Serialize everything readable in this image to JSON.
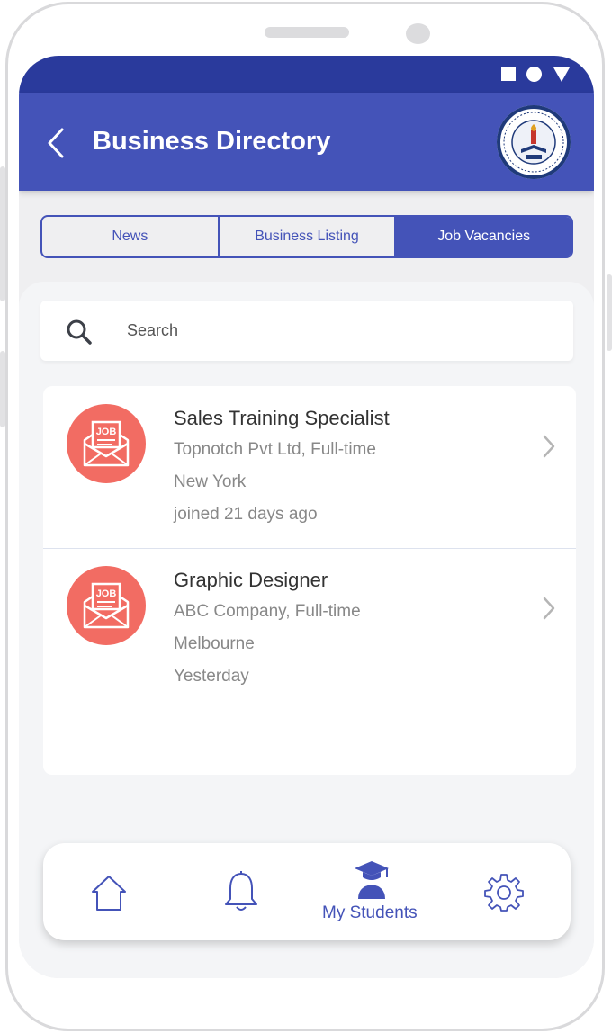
{
  "header": {
    "title": "Business Directory",
    "back_icon": "chevron-left-icon",
    "logo_icon": "school-seal-logo"
  },
  "status_bar": {
    "icons": [
      "square-icon",
      "circle-icon",
      "triangle-icon"
    ]
  },
  "tabs": [
    {
      "label": "News",
      "active": false
    },
    {
      "label": "Business Listing",
      "active": false
    },
    {
      "label": "Job Vacancies",
      "active": true
    }
  ],
  "search": {
    "placeholder": "Search",
    "icon": "search-icon"
  },
  "jobs": [
    {
      "title": "Sales Training Specialist",
      "company": "Topnotch Pvt Ltd, Full-time",
      "location": "New York",
      "posted": "joined 21 days ago",
      "icon_text": "JOB"
    },
    {
      "title": "Graphic Designer",
      "company": "ABC Company, Full-time",
      "location": "Melbourne",
      "posted": "Yesterday",
      "icon_text": "JOB"
    }
  ],
  "bottom_nav": {
    "items": [
      {
        "icon": "home-icon"
      },
      {
        "icon": "bell-icon"
      },
      {
        "icon": "graduate-icon",
        "label": "My Students"
      },
      {
        "icon": "gear-icon"
      }
    ]
  },
  "colors": {
    "primary": "#4453b8",
    "status_bar": "#2a3a9c",
    "job_icon": "#f26c63",
    "background": "#efeff1"
  }
}
